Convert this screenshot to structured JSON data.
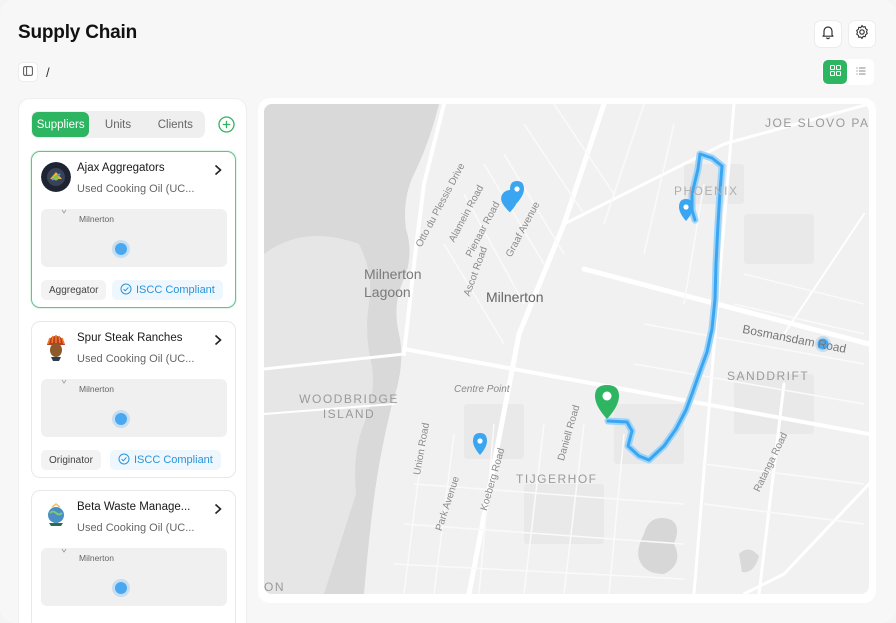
{
  "header": {
    "title": "Supply Chain"
  },
  "breadcrumb": {
    "separator": "/"
  },
  "tabs": [
    {
      "label": "Suppliers",
      "active": true
    },
    {
      "label": "Units",
      "active": false
    },
    {
      "label": "Clients",
      "active": false
    }
  ],
  "suppliers": [
    {
      "name": "Ajax Aggregators",
      "product": "Used Cooking Oil (UC...",
      "map_label": "Milnerton",
      "role": "Aggregator",
      "compliance": "ISCC Compliant",
      "selected": true
    },
    {
      "name": "Spur Steak Ranches",
      "product": "Used Cooking Oil (UC...",
      "map_label": "Milnerton",
      "role": "Originator",
      "compliance": "ISCC Compliant",
      "selected": false
    },
    {
      "name": "Beta Waste Manage...",
      "product": "Used Cooking Oil (UC...",
      "map_label": "Milnerton",
      "role": "",
      "compliance": "",
      "selected": false
    }
  ],
  "map": {
    "labels": {
      "joe_slovo_park": "JOE SLOVO PARK",
      "phoenix": "PHOENIX",
      "milnerton_lagoon": "Milnerton Lagoon",
      "milnerton": "Milnerton",
      "bosmansdam_road": "Bosmansdam Road",
      "sanddrift": "SANDDRIFT",
      "woodbridge_island": "WOODBRIDGE ISLAND",
      "centre_point": "Centre Point",
      "tijgerhof": "TIJGERHOF",
      "otto_du_plessis": "Otto du Plessis Drive",
      "alamein_road": "Alamein Road",
      "pienaar_road": "Pienaar Road",
      "graaf_avenue": "Graaf Avenue",
      "ascot_road": "Ascot Road",
      "union_road": "Union Road",
      "park_avenue": "Park Avenue",
      "koeberg_road": "Koeberg Road",
      "daniell_road": "Daniell Road",
      "ratanga_road": "Ratanga Road",
      "edge_on": "ON"
    }
  },
  "colors": {
    "accent": "#2db562",
    "route": "#3aa6f2",
    "pin_blue": "#3aa6f2",
    "pin_green": "#2db562"
  }
}
